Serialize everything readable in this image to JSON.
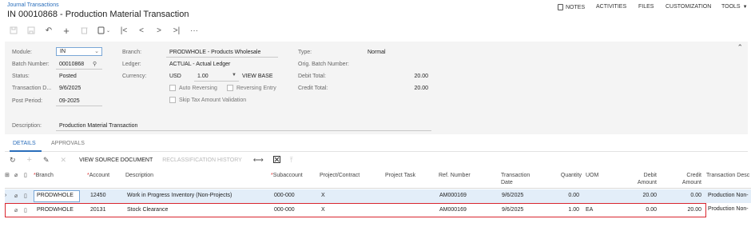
{
  "breadcrumb": "Journal Transactions",
  "title": "IN 00010868 - Production Material Transaction",
  "top_menu": {
    "notes": "NOTES",
    "activities": "ACTIVITIES",
    "files": "FILES",
    "customization": "CUSTOMIZATION",
    "tools": "TOOLS"
  },
  "toolbar_icons": [
    "save-icon",
    "save-close-icon",
    "undo-icon",
    "add-icon",
    "delete-icon",
    "copy-icon",
    "first-icon",
    "prev-icon",
    "next-icon",
    "last-icon",
    "more-icon"
  ],
  "form": {
    "module_label": "Module:",
    "module_value": "IN",
    "batch_label": "Batch Number:",
    "batch_value": "00010868",
    "status_label": "Status:",
    "status_value": "Posted",
    "trandate_label": "Transaction D...",
    "trandate_value": "9/6/2025",
    "period_label": "Post Period:",
    "period_value": "09-2025",
    "branch_label": "Branch:",
    "branch_value": "PRODWHOLE - Products Wholesale",
    "ledger_label": "Ledger:",
    "ledger_value": "ACTUAL - Actual Ledger",
    "currency_label": "Currency:",
    "currency_value": "USD",
    "rate_value": "1.00",
    "view_base": "VIEW BASE",
    "auto_reversing": "Auto Reversing",
    "reversing_entry": "Reversing Entry",
    "skip_tax": "Skip Tax Amount Validation",
    "type_label": "Type:",
    "type_value": "Normal",
    "orig_batch_label": "Orig. Batch Number:",
    "orig_batch_value": "",
    "debit_total_label": "Debit Total:",
    "debit_total_value": "20.00",
    "credit_total_label": "Credit Total:",
    "credit_total_value": "20.00",
    "description_label": "Description:",
    "description_value": "Production Material Transaction"
  },
  "tabs": [
    "DETAILS",
    "APPROVALS"
  ],
  "grid_toolbar": {
    "view_source": "VIEW SOURCE DOCUMENT",
    "reclass_history": "RECLASSIFICATION HISTORY"
  },
  "columns": {
    "branch": "Branch",
    "account": "Account",
    "description": "Description",
    "subaccount": "Subaccount",
    "project": "Project/Contract",
    "project_task": "Project Task",
    "ref_number": "Ref. Number",
    "tran_date_1": "Transaction",
    "tran_date_2": "Date",
    "quantity": "Quantity",
    "uom": "UOM",
    "debit_1": "Debit",
    "debit_2": "Amount",
    "credit_1": "Credit",
    "credit_2": "Amount",
    "tran_desc": "Transaction Desc"
  },
  "rows": [
    {
      "branch": "PRODWHOLE",
      "account": "12450",
      "description": "Work in Progress Inventory (Non-Projects)",
      "subaccount": "000-000",
      "project": "X",
      "project_task": "",
      "ref_number": "AM000169",
      "tran_date": "9/6/2025",
      "quantity": "0.00",
      "uom": "",
      "debit": "20.00",
      "credit": "0.00",
      "tran_desc": "Production Non-"
    },
    {
      "branch": "PRODWHOLE",
      "account": "20131",
      "description": "Stock Clearance",
      "subaccount": "000-000",
      "project": "X",
      "project_task": "",
      "ref_number": "AM000169",
      "tran_date": "9/6/2025",
      "quantity": "1.00",
      "uom": "EA",
      "debit": "0.00",
      "credit": "20.00",
      "tran_desc": "Production Non-"
    }
  ],
  "colors": {
    "accent": "#2a6ebb",
    "selected_row": "#e3eef9",
    "highlight_border": "#d9262f",
    "form_bg": "#f4f4f4"
  }
}
